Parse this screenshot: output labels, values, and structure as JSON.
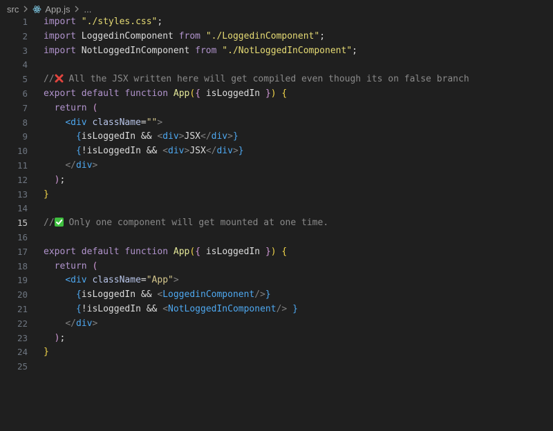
{
  "breadcrumb": {
    "folder": "src",
    "file": "App.js",
    "more": "..."
  },
  "icons": {
    "react": "react-icon",
    "cross": "cross-mark-emoji",
    "check": "check-mark-emoji"
  },
  "colors": {
    "background": "#1f1f1f",
    "keyword": "#b294ce",
    "string": "#d7c98e",
    "function": "#e5e99a",
    "comment": "#8a8a8a",
    "tag": "#4ea8f0"
  },
  "editor": {
    "active_line": 15,
    "lines": [
      {
        "num": "1",
        "tokens": [
          [
            "import",
            "kw-purple"
          ],
          [
            " ",
            ""
          ],
          [
            "\"./styles.css\"",
            "str-imp"
          ],
          [
            ";",
            "ident"
          ]
        ]
      },
      {
        "num": "2",
        "tokens": [
          [
            "import",
            "kw-purple"
          ],
          [
            " LoggedinComponent ",
            "ident"
          ],
          [
            "from",
            "kw-purple"
          ],
          [
            " ",
            ""
          ],
          [
            "\"./LoggedinComponent\"",
            "str-imp"
          ],
          [
            ";",
            "ident"
          ]
        ]
      },
      {
        "num": "3",
        "tokens": [
          [
            "import",
            "kw-purple"
          ],
          [
            " NotLoggedInComponent ",
            "ident"
          ],
          [
            "from",
            "kw-purple"
          ],
          [
            " ",
            ""
          ],
          [
            "\"./NotLoggedInComponent\"",
            "str-imp"
          ],
          [
            ";",
            "ident"
          ]
        ]
      },
      {
        "num": "4",
        "tokens": []
      },
      {
        "num": "5",
        "tokens": [
          [
            "//",
            "comment"
          ],
          [
            "",
            "emoji-x"
          ],
          [
            " All the JSX written here will get compiled even though its on false branch",
            "comment"
          ]
        ]
      },
      {
        "num": "6",
        "tokens": [
          [
            "export",
            "kw-purple"
          ],
          [
            " ",
            ""
          ],
          [
            "default",
            "kw-purple"
          ],
          [
            " ",
            ""
          ],
          [
            "function",
            "kw-purple"
          ],
          [
            " ",
            ""
          ],
          [
            "App",
            "fn"
          ],
          [
            "(",
            "brace-y"
          ],
          [
            "{",
            "paren1"
          ],
          [
            " isLoggedIn ",
            "ident"
          ],
          [
            "}",
            "paren1"
          ],
          [
            ")",
            "brace-y"
          ],
          [
            " ",
            ""
          ],
          [
            "{",
            "brace-y"
          ]
        ]
      },
      {
        "num": "7",
        "tokens": [
          [
            "  return",
            "kw-purple"
          ],
          [
            " ",
            ""
          ],
          [
            "(",
            "paren1"
          ]
        ]
      },
      {
        "num": "8",
        "tokens": [
          [
            "    ",
            ""
          ],
          [
            "<div",
            "tag"
          ],
          [
            " ",
            ""
          ],
          [
            "className",
            "attr"
          ],
          [
            "=",
            "ident"
          ],
          [
            "\"\"",
            "attr-str"
          ],
          [
            ">",
            "punct"
          ]
        ]
      },
      {
        "num": "9",
        "tokens": [
          [
            "      ",
            ""
          ],
          [
            "{",
            "paren2"
          ],
          [
            "isLoggedIn && ",
            "ident"
          ],
          [
            "<",
            "punct"
          ],
          [
            "div",
            "tag"
          ],
          [
            ">",
            "punct"
          ],
          [
            "JSX",
            "text"
          ],
          [
            "</",
            "punct"
          ],
          [
            "div",
            "tag"
          ],
          [
            ">",
            "punct"
          ],
          [
            "}",
            "paren2"
          ]
        ]
      },
      {
        "num": "10",
        "tokens": [
          [
            "      ",
            ""
          ],
          [
            "{",
            "paren2"
          ],
          [
            "!isLoggedIn && ",
            "ident"
          ],
          [
            "<",
            "punct"
          ],
          [
            "div",
            "tag"
          ],
          [
            ">",
            "punct"
          ],
          [
            "JSX",
            "text"
          ],
          [
            "</",
            "punct"
          ],
          [
            "div",
            "tag"
          ],
          [
            ">",
            "punct"
          ],
          [
            "}",
            "paren2"
          ]
        ]
      },
      {
        "num": "11",
        "tokens": [
          [
            "    ",
            ""
          ],
          [
            "</",
            "punct"
          ],
          [
            "div",
            "tag"
          ],
          [
            ">",
            "punct"
          ]
        ]
      },
      {
        "num": "12",
        "tokens": [
          [
            "  ",
            ""
          ],
          [
            ")",
            "paren1"
          ],
          [
            ";",
            "ident"
          ]
        ]
      },
      {
        "num": "13",
        "tokens": [
          [
            "}",
            "brace-y"
          ]
        ]
      },
      {
        "num": "14",
        "tokens": []
      },
      {
        "num": "15",
        "tokens": [
          [
            "//",
            "comment"
          ],
          [
            "",
            "emoji-check"
          ],
          [
            " Only one component will get mounted at one time.",
            "comment"
          ]
        ]
      },
      {
        "num": "16",
        "tokens": []
      },
      {
        "num": "17",
        "tokens": [
          [
            "export",
            "kw-purple"
          ],
          [
            " ",
            ""
          ],
          [
            "default",
            "kw-purple"
          ],
          [
            " ",
            ""
          ],
          [
            "function",
            "kw-purple"
          ],
          [
            " ",
            ""
          ],
          [
            "App",
            "fn"
          ],
          [
            "(",
            "brace-y"
          ],
          [
            "{",
            "paren1"
          ],
          [
            " isLoggedIn ",
            "ident"
          ],
          [
            "}",
            "paren1"
          ],
          [
            ")",
            "brace-y"
          ],
          [
            " ",
            ""
          ],
          [
            "{",
            "brace-y"
          ]
        ]
      },
      {
        "num": "18",
        "tokens": [
          [
            "  return",
            "kw-purple"
          ],
          [
            " ",
            ""
          ],
          [
            "(",
            "paren1"
          ]
        ]
      },
      {
        "num": "19",
        "tokens": [
          [
            "    ",
            ""
          ],
          [
            "<div",
            "tag"
          ],
          [
            " ",
            ""
          ],
          [
            "className",
            "attr"
          ],
          [
            "=",
            "ident"
          ],
          [
            "\"App\"",
            "attr-str"
          ],
          [
            ">",
            "punct"
          ]
        ]
      },
      {
        "num": "20",
        "tokens": [
          [
            "      ",
            ""
          ],
          [
            "{",
            "paren2"
          ],
          [
            "isLoggedIn && ",
            "ident"
          ],
          [
            "<",
            "punct"
          ],
          [
            "LoggedinComponent",
            "tag"
          ],
          [
            "/>",
            "punct"
          ],
          [
            "}",
            "paren2"
          ]
        ]
      },
      {
        "num": "21",
        "tokens": [
          [
            "      ",
            ""
          ],
          [
            "{",
            "paren2"
          ],
          [
            "!isLoggedIn && ",
            "ident"
          ],
          [
            "<",
            "punct"
          ],
          [
            "NotLoggedInComponent",
            "tag"
          ],
          [
            "/>",
            "punct"
          ],
          [
            " ",
            ""
          ],
          [
            "}",
            "paren2"
          ]
        ]
      },
      {
        "num": "22",
        "tokens": [
          [
            "    ",
            ""
          ],
          [
            "</",
            "punct"
          ],
          [
            "div",
            "tag"
          ],
          [
            ">",
            "punct"
          ]
        ]
      },
      {
        "num": "23",
        "tokens": [
          [
            "  ",
            ""
          ],
          [
            ")",
            "paren1"
          ],
          [
            ";",
            "ident"
          ]
        ]
      },
      {
        "num": "24",
        "tokens": [
          [
            "}",
            "brace-y"
          ]
        ]
      },
      {
        "num": "25",
        "tokens": []
      }
    ]
  }
}
